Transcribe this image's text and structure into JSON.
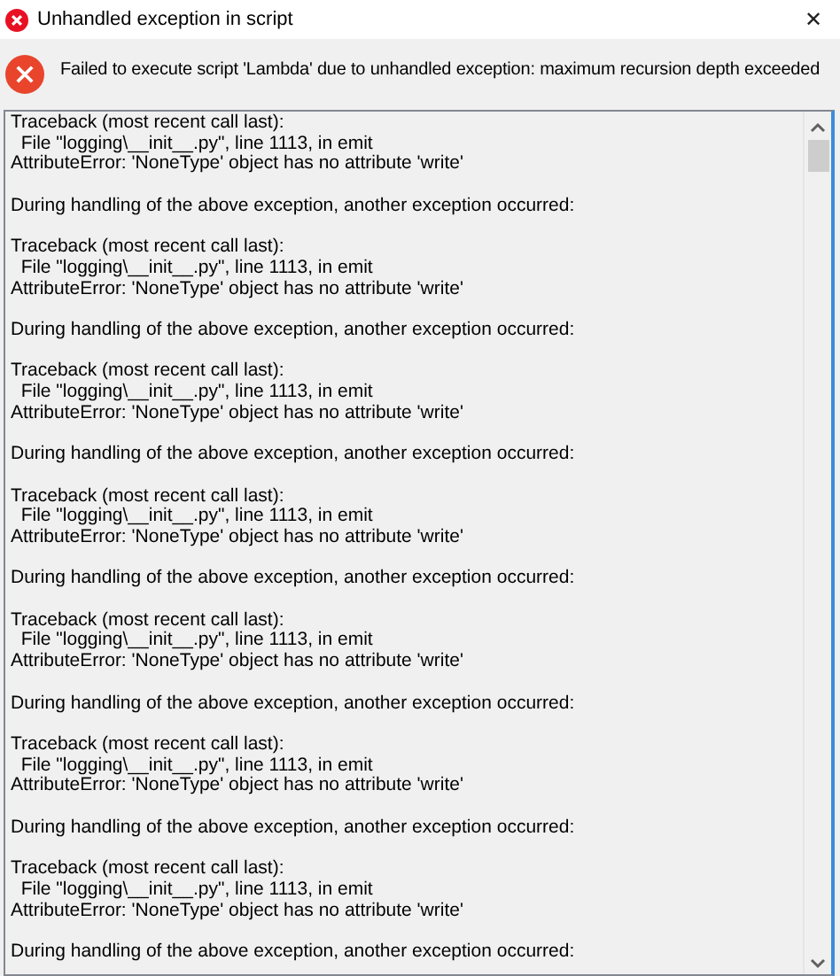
{
  "window": {
    "title": "Unhandled exception in script",
    "close": "✕"
  },
  "message": "Failed to execute script 'Lambda' due to unhandled exception: maximum recursion depth exceeded",
  "log_blocks": [
    {
      "lines": [
        "Traceback (most recent call last):",
        "  File \"logging\\__init__.py\", line 1113, in emit",
        "AttributeError: 'NoneType' object has no attribute 'write'"
      ],
      "note": "During handling of the above exception, another exception occurred:"
    },
    {
      "lines": [
        "Traceback (most recent call last):",
        "  File \"logging\\__init__.py\", line 1113, in emit",
        "AttributeError: 'NoneType' object has no attribute 'write'"
      ],
      "note": "During handling of the above exception, another exception occurred:"
    },
    {
      "lines": [
        "Traceback (most recent call last):",
        "  File \"logging\\__init__.py\", line 1113, in emit",
        "AttributeError: 'NoneType' object has no attribute 'write'"
      ],
      "note": "During handling of the above exception, another exception occurred:"
    },
    {
      "lines": [
        "Traceback (most recent call last):",
        "  File \"logging\\__init__.py\", line 1113, in emit",
        "AttributeError: 'NoneType' object has no attribute 'write'"
      ],
      "note": "During handling of the above exception, another exception occurred:"
    },
    {
      "lines": [
        "Traceback (most recent call last):",
        "  File \"logging\\__init__.py\", line 1113, in emit",
        "AttributeError: 'NoneType' object has no attribute 'write'"
      ],
      "note": "During handling of the above exception, another exception occurred:"
    },
    {
      "lines": [
        "Traceback (most recent call last):",
        "  File \"logging\\__init__.py\", line 1113, in emit",
        "AttributeError: 'NoneType' object has no attribute 'write'"
      ],
      "note": "During handling of the above exception, another exception occurred:"
    },
    {
      "lines": [
        "Traceback (most recent call last):",
        "  File \"logging\\__init__.py\", line 1113, in emit",
        "AttributeError: 'NoneType' object has no attribute 'write'"
      ],
      "note": "During handling of the above exception, another exception occurred:"
    }
  ]
}
